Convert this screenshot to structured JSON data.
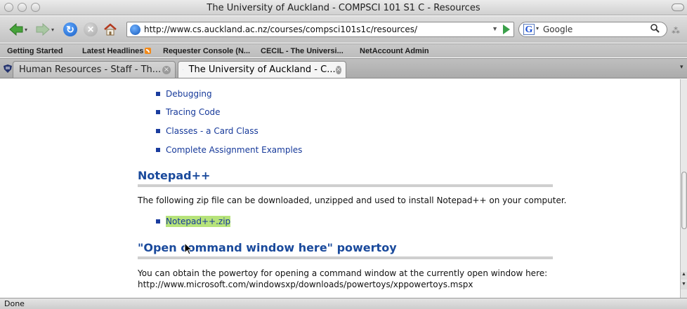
{
  "window": {
    "title": "The University of Auckland - COMPSCI 101 S1 C - Resources"
  },
  "toolbar": {
    "url": "http://www.cs.auckland.ac.nz/courses/compsci101s1c/resources/",
    "search_engine": "Google",
    "search_placeholder": "Google",
    "icons": [
      "back-arrow-icon",
      "forward-arrow-icon",
      "reload-icon",
      "stop-icon",
      "home-icon",
      "globe-icon",
      "go-arrow-icon",
      "search-icon"
    ]
  },
  "bookmarks": [
    {
      "label": "Getting Started"
    },
    {
      "label": "Latest Headlines"
    },
    {
      "label": "Requester Console (N..."
    },
    {
      "label": "CECIL - The Universi..."
    },
    {
      "label": "NetAccount Admin"
    }
  ],
  "tabs": [
    {
      "label": "Human Resources - Staff - Th...",
      "active": false
    },
    {
      "label": "The University of Auckland - C...",
      "active": true
    }
  ],
  "content": {
    "list_top": [
      {
        "label": "Debugging"
      },
      {
        "label": "Tracing Code"
      },
      {
        "label": "Classes - a Card Class"
      },
      {
        "label": "Complete Assignment Examples"
      }
    ],
    "notepad_heading": "Notepad++",
    "notepad_text": "The following zip file can be downloaded, unzipped and used to install Notepad++ on your computer.",
    "notepad_link": "Notepad++.zip",
    "powertoy_heading": "\"Open command window here\" powertoy",
    "powertoy_text": "You can obtain the powertoy for opening a command window at the currently open window here:",
    "powertoy_link": "http://www.microsoft.com/windowsxp/downloads/powertoys/xppowertoys.mspx"
  },
  "status": {
    "text": "Done"
  },
  "colors": {
    "link": "#16399a",
    "heading": "#1a4a9c",
    "highlight": "#b6e37a"
  }
}
